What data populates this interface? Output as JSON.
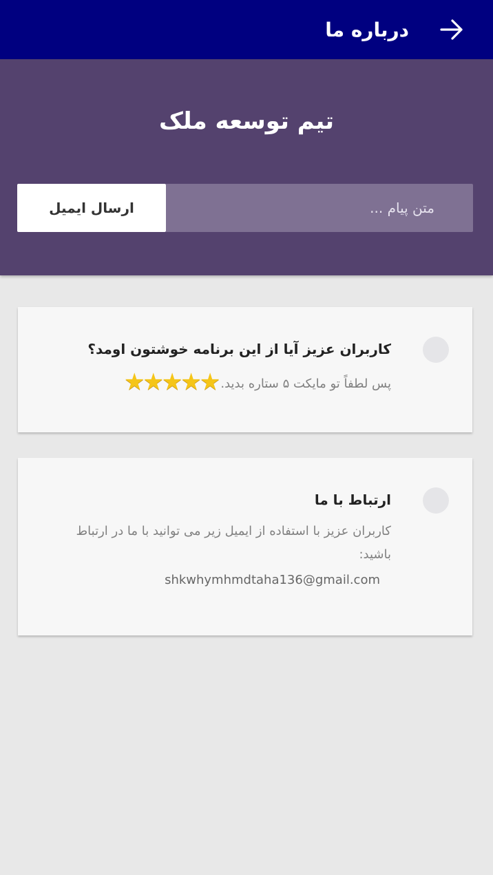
{
  "app_bar": {
    "title": "درباره ما",
    "back_icon": "arrow-right-icon"
  },
  "hero": {
    "title": "تیم توسعه ملک",
    "input_placeholder": "متن پیام ...",
    "send_label": "ارسال ایمیل"
  },
  "cards": [
    {
      "title": "کاربران عزیز آیا از این برنامه خوشتون اومد؟",
      "text": "پس لطفاً تو مایکت ۵ ستاره بدید.",
      "stars": 5
    },
    {
      "title": "ارتباط با ما",
      "text": "کاربران عزیز با استفاده از ایمیل زیر می توانید با ما در ارتباط باشید:",
      "email": "shkwhymhmdtaha136@gmail.com"
    }
  ],
  "colors": {
    "app_bar": "#000080",
    "hero": "#54426e",
    "input": "#7f7193",
    "background": "#e8e8e8",
    "card": "#f7f7f7",
    "star": "#f5c518"
  }
}
